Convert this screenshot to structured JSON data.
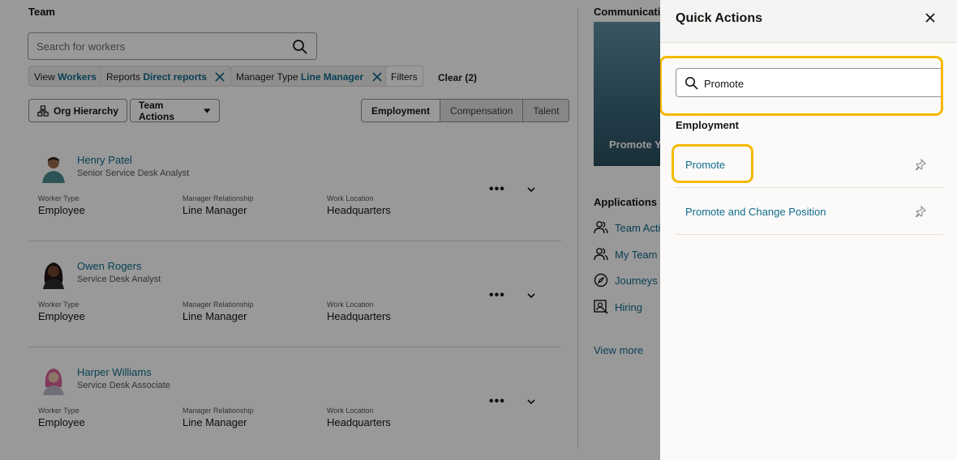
{
  "team": {
    "title": "Team",
    "search_placeholder": "Search for workers",
    "filters": [
      {
        "label": "View",
        "value": "Workers",
        "removable": false
      },
      {
        "label": "Reports",
        "value": "Direct reports",
        "removable": true
      },
      {
        "label": "Manager Type",
        "value": "Line Manager",
        "removable": true
      }
    ],
    "filters_button": "Filters",
    "clear_link": "Clear (2)",
    "org_hierarchy": "Org Hierarchy",
    "team_actions": "Team Actions",
    "tabs": [
      "Employment",
      "Compensation",
      "Talent"
    ],
    "field_labels": {
      "worker_type": "Worker Type",
      "manager_relationship": "Manager Relationship",
      "work_location": "Work Location"
    },
    "workers": [
      {
        "name": "Henry Patel",
        "title": "Senior Service Desk Analyst",
        "worker_type": "Employee",
        "manager_relationship": "Line Manager",
        "work_location": "Headquarters"
      },
      {
        "name": "Owen Rogers",
        "title": "Service Desk Analyst",
        "worker_type": "Employee",
        "manager_relationship": "Line Manager",
        "work_location": "Headquarters"
      },
      {
        "name": "Harper Williams",
        "title": "Service Desk Associate",
        "worker_type": "Employee",
        "manager_relationship": "Line Manager",
        "work_location": "Headquarters"
      }
    ]
  },
  "sidebar": {
    "communications_title": "Communicatio",
    "communications_card": "Promote Y",
    "applications_title": "Applications",
    "apps": [
      {
        "label": "Team Acti",
        "icon": "people-icon"
      },
      {
        "label": "My Team",
        "icon": "people-icon"
      },
      {
        "label": "Journeys",
        "icon": "compass-icon"
      },
      {
        "label": "Hiring",
        "icon": "person-search-icon"
      }
    ],
    "view_more": "View more"
  },
  "quick_actions": {
    "title": "Quick Actions",
    "search_value": "Promote",
    "group": "Employment",
    "items": [
      "Promote",
      "Promote and Change Position"
    ],
    "highlight_color": "#f5b800"
  },
  "colors": {
    "link": "#0f6c8c",
    "highlight": "#f5b800"
  }
}
